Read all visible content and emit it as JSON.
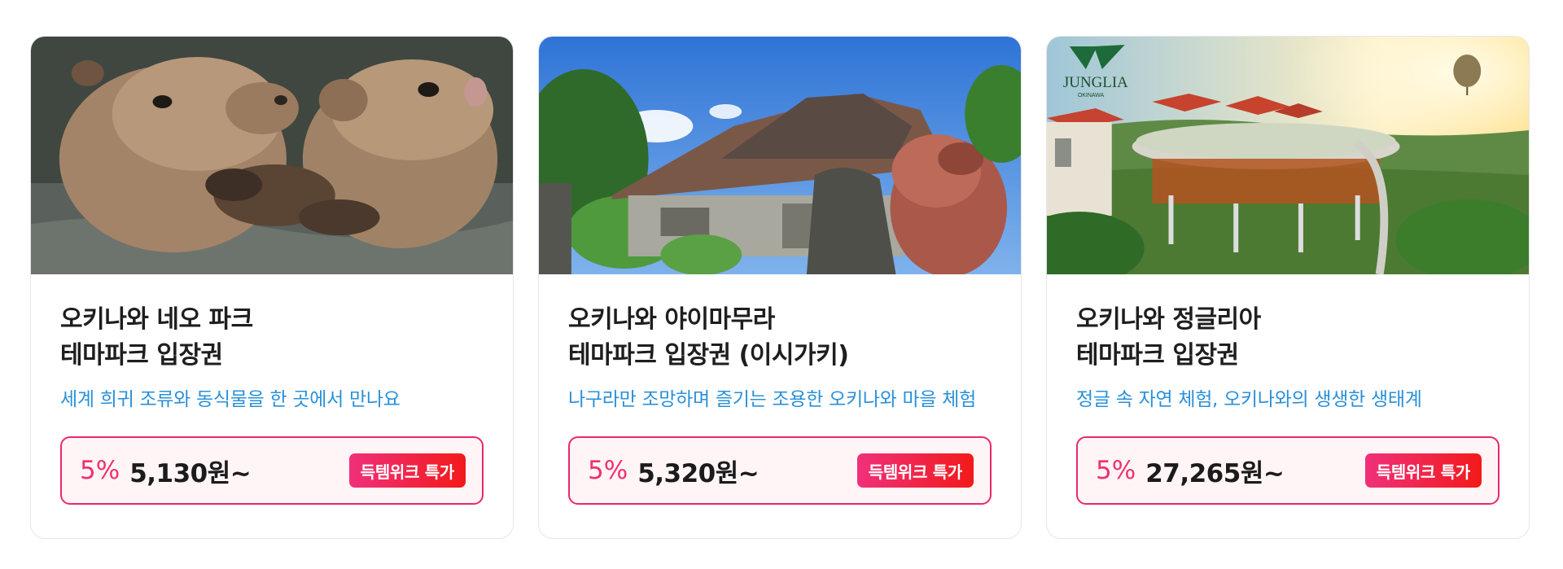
{
  "cards": [
    {
      "title_line1": "오키나와 네오 파크",
      "title_line2": "테마파크 입장권",
      "description": "세계 희귀 조류와 동식물을 한 곳에서 만나요",
      "discount": "5%",
      "price": "5,130원~",
      "badge": "득템위크 특가"
    },
    {
      "title_line1": "오키나와 야이마무라",
      "title_line2": "테마파크 입장권 (이시가키)",
      "description": "나구라만 조망하며 즐기는 조용한 오키나와 마을 체험",
      "discount": "5%",
      "price": "5,320원~",
      "badge": "득템위크 특가"
    },
    {
      "title_line1": "오키나와 정글리아",
      "title_line2": "테마파크 입장권",
      "description": "정글 속 자연 체험, 오키나와의 생생한 생태계",
      "discount": "5%",
      "price": "27,265원~",
      "badge": "득템위크 특가",
      "logo_text": "JUNGLIA",
      "logo_subtext": "OKINAWA"
    }
  ],
  "colors": {
    "description": "#2a90d8",
    "discount": "#f0306e",
    "price_border": "#e8296a",
    "badge_gradient_start": "#f0307a",
    "badge_gradient_end": "#f21a1a"
  }
}
